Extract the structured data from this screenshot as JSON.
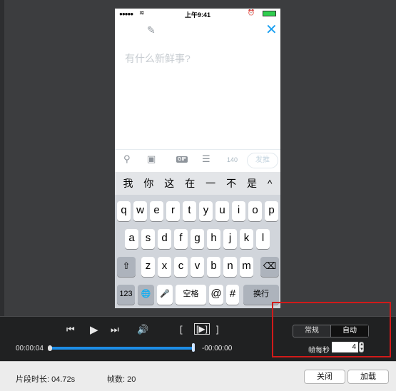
{
  "phone": {
    "status": {
      "signal": "●●●●●",
      "time": "上午9:41"
    },
    "compose": {
      "placeholder": "有什么新鲜事?",
      "char_count": "140",
      "send_label": "发推"
    },
    "candidates": [
      "我",
      "你",
      "这",
      "在",
      "一",
      "不",
      "是",
      "^"
    ],
    "keyboard": {
      "row1": [
        "q",
        "w",
        "e",
        "r",
        "t",
        "y",
        "u",
        "i",
        "o",
        "p"
      ],
      "row2": [
        "a",
        "s",
        "d",
        "f",
        "g",
        "h",
        "j",
        "k",
        "l"
      ],
      "row3": [
        "z",
        "x",
        "c",
        "v",
        "b",
        "n",
        "m"
      ],
      "shift": "⇧",
      "delete": "⌫",
      "num": "123",
      "globe": "🌐",
      "mic": "🎤",
      "space": "空格",
      "at": "@",
      "hash": "#",
      "return": "换行"
    }
  },
  "player": {
    "current_time": "00:00:04",
    "remaining_time": "-00:00:00",
    "progress": 1.0
  },
  "mode": {
    "options": [
      "常规",
      "自动"
    ],
    "selected": "自动",
    "fps_label": "帧每秒",
    "fps_value": "4"
  },
  "footer": {
    "duration_label": "片段时长: 04.72s",
    "frames_label": "帧数: 20",
    "close_label": "关闭",
    "load_label": "加载"
  },
  "colors": {
    "accent": "#1da1f2",
    "progress": "#1d8de6",
    "highlight_box": "#d11a1a"
  }
}
